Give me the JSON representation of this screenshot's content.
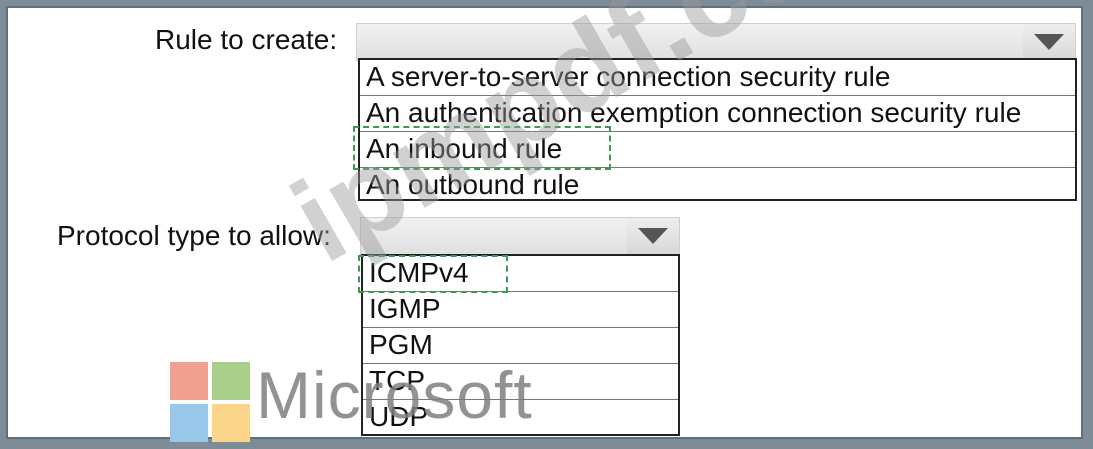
{
  "rule_field": {
    "label": "Rule to create:",
    "selected": "",
    "options": [
      "A server-to-server connection security rule",
      "An authentication exemption connection security rule",
      "An inbound rule",
      "An outbound rule"
    ],
    "highlighted_option": "An inbound rule"
  },
  "protocol_field": {
    "label": "Protocol type to allow:",
    "selected": "",
    "options": [
      "ICMPv4",
      "IGMP",
      "PGM",
      "TCP",
      "UDP"
    ],
    "highlighted_option": "ICMPv4"
  },
  "branding": {
    "logo_text": "Microsoft",
    "logo_colors": [
      "#f25022",
      "#7fba00",
      "#00a4ef",
      "#ffb900"
    ]
  },
  "watermark": {
    "text": "ipmpdf.com"
  },
  "icons": {
    "dropdown": "chevron-down-icon",
    "logo": "microsoft-logo-icon"
  },
  "colors": {
    "highlight_dash": "#3a9a55",
    "page_border": "#7e8c97"
  }
}
